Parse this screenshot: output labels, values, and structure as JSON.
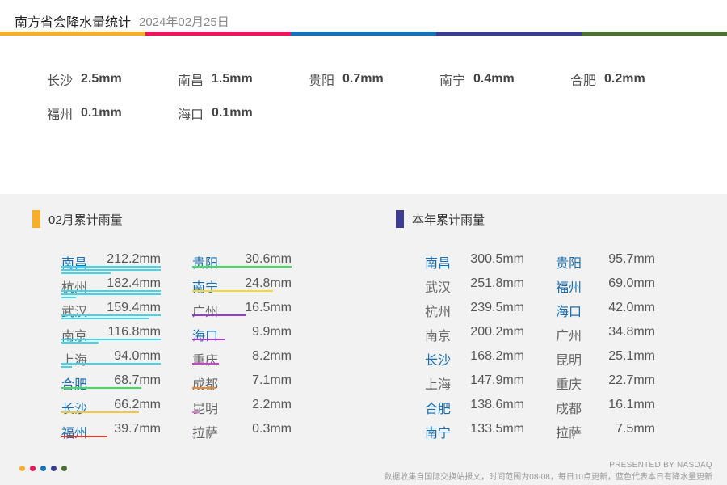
{
  "header": {
    "title": "南方省会降水量统计",
    "date": "2024年02月25日",
    "bar_colors": [
      "#f6ae2d",
      "#e8185a",
      "#1273b8",
      "#3d3d8f",
      "#4a7132"
    ]
  },
  "today": [
    {
      "city": "长沙",
      "value": "2.5mm"
    },
    {
      "city": "南昌",
      "value": "1.5mm"
    },
    {
      "city": "贵阳",
      "value": "0.7mm"
    },
    {
      "city": "南宁",
      "value": "0.4mm"
    },
    {
      "city": "合肥",
      "value": "0.2mm"
    },
    {
      "city": "福州",
      "value": "0.1mm"
    },
    {
      "city": "海口",
      "value": "0.1mm"
    }
  ],
  "monthly": {
    "title": "02月累计雨量",
    "marker_color": "#f6ae2d",
    "left": [
      {
        "city": "南昌",
        "value": "212.2mm",
        "num": 212.2,
        "blue": true,
        "color": "#3ed6e8"
      },
      {
        "city": "杭州",
        "value": "182.4mm",
        "num": 182.4,
        "blue": false,
        "color": "#3ed6e8"
      },
      {
        "city": "武汉",
        "value": "159.4mm",
        "num": 159.4,
        "blue": false,
        "color": "#3ed6e8"
      },
      {
        "city": "南京",
        "value": "116.8mm",
        "num": 116.8,
        "blue": false,
        "color": "#3ed6e8"
      },
      {
        "city": "上海",
        "value": "94.0mm",
        "num": 94.0,
        "blue": false,
        "color": "#3ed6e8"
      },
      {
        "city": "合肥",
        "value": "68.7mm",
        "num": 68.7,
        "blue": true,
        "color": "#3ee05a"
      },
      {
        "city": "长沙",
        "value": "66.2mm",
        "num": 66.2,
        "blue": true,
        "color": "#f6c83a"
      },
      {
        "city": "福州",
        "value": "39.7mm",
        "num": 39.7,
        "blue": true,
        "color": "#e83a2a"
      }
    ],
    "right": [
      {
        "city": "贵阳",
        "value": "30.6mm",
        "num": 30.6,
        "blue": true,
        "color": "#3ee05a"
      },
      {
        "city": "南宁",
        "value": "24.8mm",
        "num": 24.8,
        "blue": true,
        "color": "#f6d83a"
      },
      {
        "city": "广州",
        "value": "16.5mm",
        "num": 16.5,
        "blue": false,
        "color": "#9a3ad6"
      },
      {
        "city": "海口",
        "value": "9.9mm",
        "num": 9.9,
        "blue": true,
        "color": "#b03ad6"
      },
      {
        "city": "重庆",
        "value": "8.2mm",
        "num": 8.2,
        "blue": false,
        "color": "#d63ad6"
      },
      {
        "city": "成都",
        "value": "7.1mm",
        "num": 7.1,
        "blue": false,
        "color": "#f08a2a"
      },
      {
        "city": "昆明",
        "value": "2.2mm",
        "num": 2.2,
        "blue": false,
        "color": "#e07ad6"
      },
      {
        "city": "拉萨",
        "value": "0.3mm",
        "num": 0.3,
        "blue": false,
        "color": "#e8a0e0"
      }
    ]
  },
  "yearly": {
    "title": "本年累计雨量",
    "marker_color": "#3d3d8f",
    "left": [
      {
        "city": "南昌",
        "value": "300.5mm",
        "blue": true
      },
      {
        "city": "武汉",
        "value": "251.8mm",
        "blue": false
      },
      {
        "city": "杭州",
        "value": "239.5mm",
        "blue": false
      },
      {
        "city": "南京",
        "value": "200.2mm",
        "blue": false
      },
      {
        "city": "长沙",
        "value": "168.2mm",
        "blue": true
      },
      {
        "city": "上海",
        "value": "147.9mm",
        "blue": false
      },
      {
        "city": "合肥",
        "value": "138.6mm",
        "blue": true
      },
      {
        "city": "南宁",
        "value": "133.5mm",
        "blue": true
      }
    ],
    "right": [
      {
        "city": "贵阳",
        "value": "95.7mm",
        "blue": true
      },
      {
        "city": "福州",
        "value": "69.0mm",
        "blue": true
      },
      {
        "city": "海口",
        "value": "42.0mm",
        "blue": true
      },
      {
        "city": "广州",
        "value": "34.8mm",
        "blue": false
      },
      {
        "city": "昆明",
        "value": "25.1mm",
        "blue": false
      },
      {
        "city": "重庆",
        "value": "22.7mm",
        "blue": false
      },
      {
        "city": "成都",
        "value": "16.1mm",
        "blue": false
      },
      {
        "city": "拉萨",
        "value": "7.5mm",
        "blue": false
      }
    ]
  },
  "footer": {
    "presented": "PRESENTED BY NASDAQ",
    "note": "数据收集自国际交换站报文，时间范围为08-08，每日10点更新，蓝色代表本日有降水量更新"
  }
}
